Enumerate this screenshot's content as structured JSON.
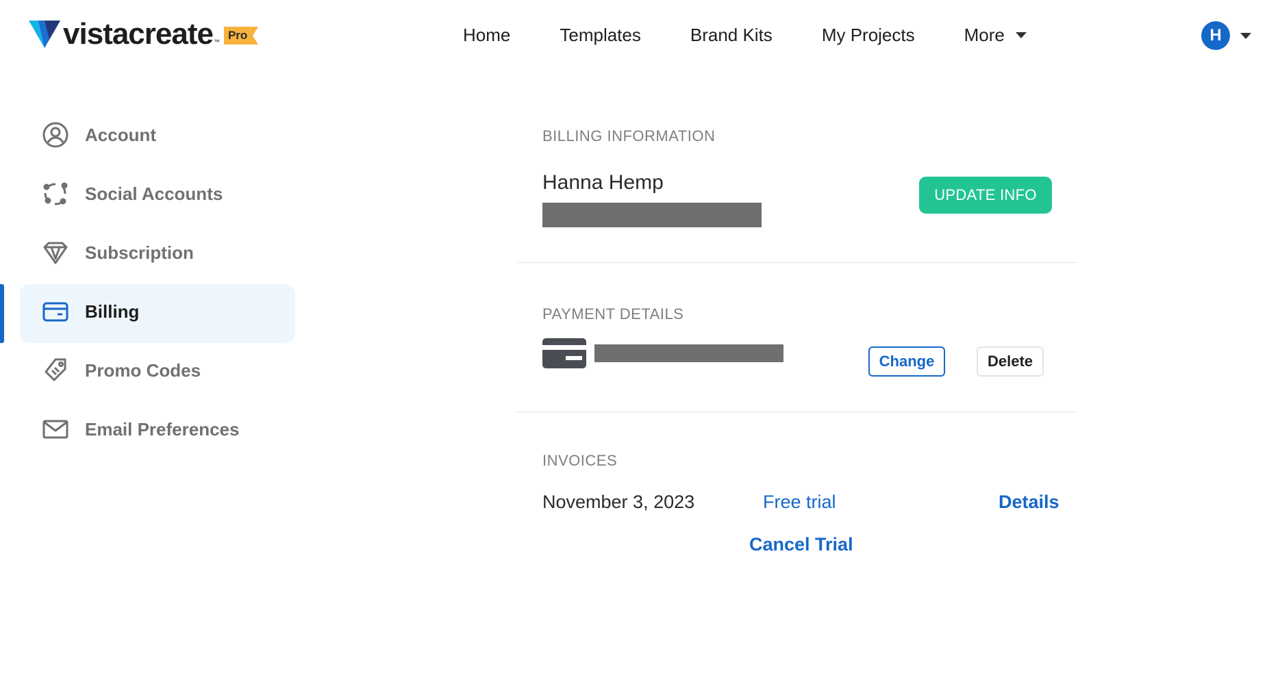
{
  "brand": {
    "name_part1": "vista",
    "name_part2": "create",
    "tm": "™",
    "badge": "Pro",
    "primary_color": "#1668c8",
    "accent_color": "#22c493",
    "badge_color": "#f6b23c"
  },
  "nav": {
    "items": [
      {
        "label": "Home"
      },
      {
        "label": "Templates"
      },
      {
        "label": "Brand Kits"
      },
      {
        "label": "My Projects"
      },
      {
        "label": "More"
      }
    ]
  },
  "user": {
    "avatar_initial": "H"
  },
  "sidebar": {
    "items": [
      {
        "label": "Account",
        "icon": "account-circle-icon"
      },
      {
        "label": "Social Accounts",
        "icon": "social-network-icon"
      },
      {
        "label": "Subscription",
        "icon": "diamond-icon"
      },
      {
        "label": "Billing",
        "icon": "credit-card-icon",
        "active": true
      },
      {
        "label": "Promo Codes",
        "icon": "tag-icon"
      },
      {
        "label": "Email Preferences",
        "icon": "envelope-icon"
      }
    ]
  },
  "billing_info": {
    "title": "BILLING INFORMATION",
    "name": "Hanna Hemp",
    "update_button": "UPDATE INFO"
  },
  "payment_details": {
    "title": "PAYMENT DETAILS",
    "change_button": "Change",
    "delete_button": "Delete"
  },
  "invoices": {
    "title": "INVOICES",
    "rows": [
      {
        "date": "November 3, 2023",
        "type": "Free trial",
        "details_link": "Details"
      }
    ],
    "cancel_link": "Cancel Trial"
  }
}
